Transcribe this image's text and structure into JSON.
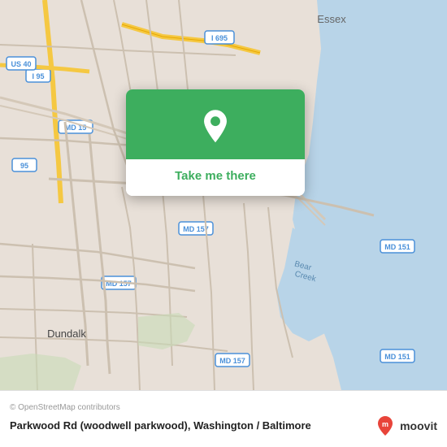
{
  "map": {
    "alt": "Map of Parkwood Rd area near Baltimore/Dundalk Maryland"
  },
  "popup": {
    "button_label": "Take me there",
    "pin_color": "#3dae5e"
  },
  "bottom_bar": {
    "copyright": "© OpenStreetMap contributors",
    "location_title": "Parkwood Rd (woodwell parkwood), Washington / Baltimore",
    "moovit_label": "moovit"
  }
}
